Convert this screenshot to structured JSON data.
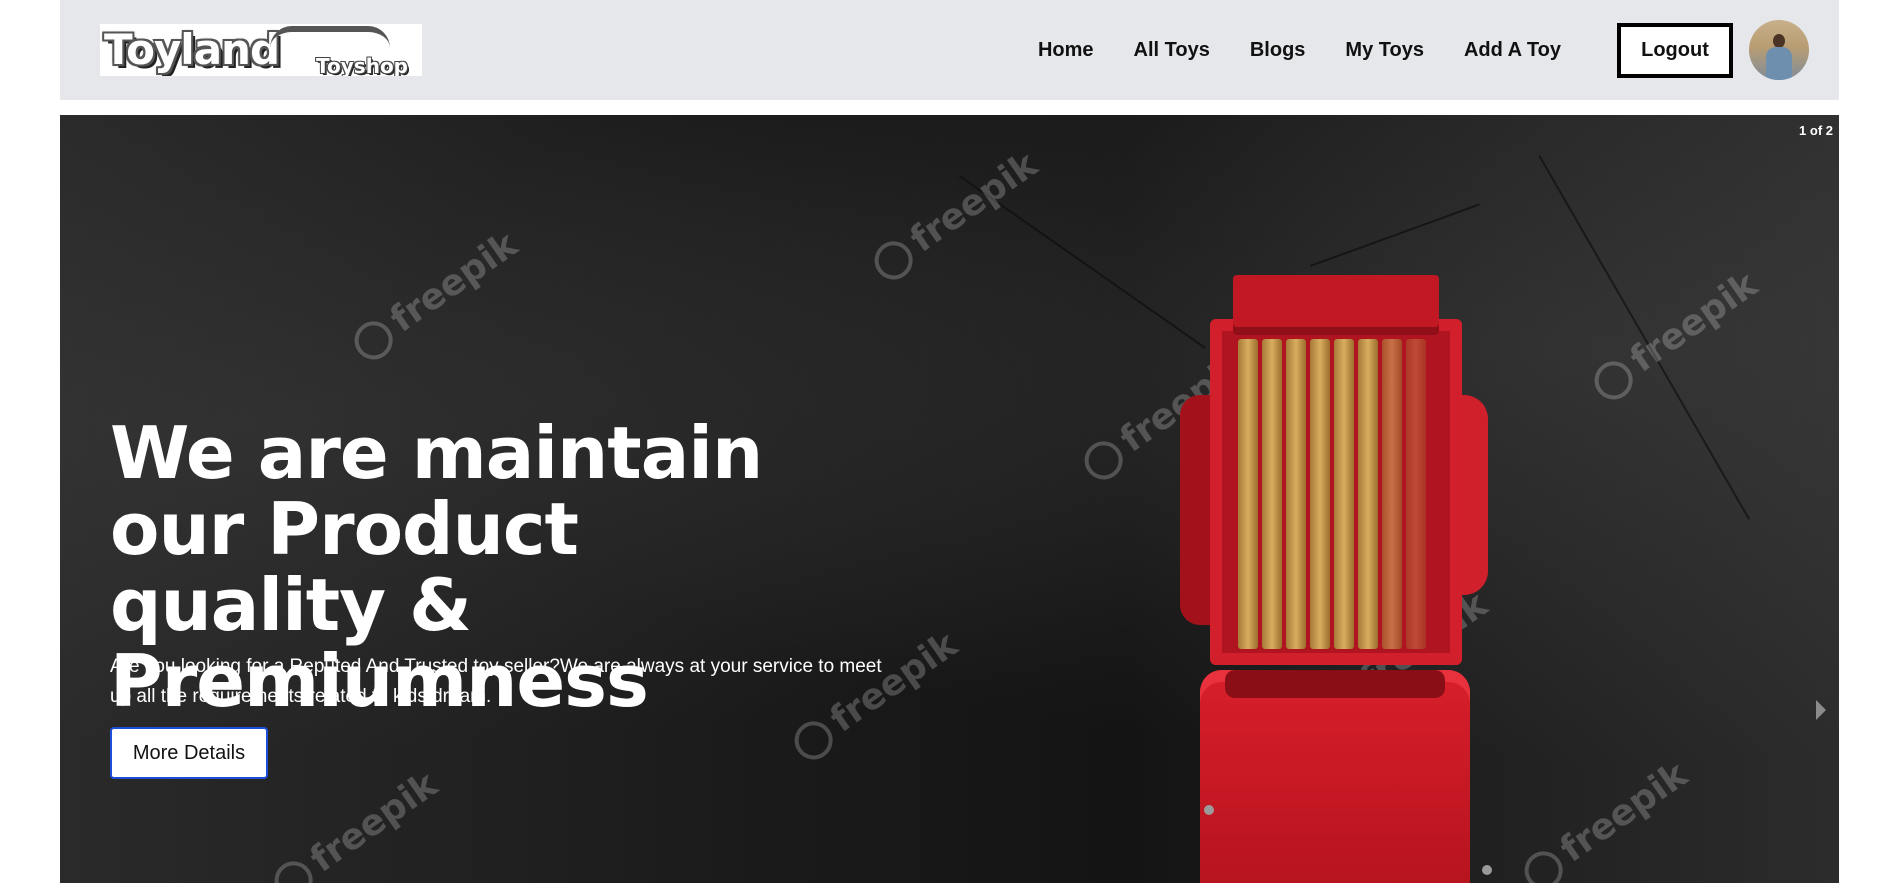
{
  "navbar": {
    "logo_text": "Toyland",
    "logo_subtext": "Toyshop",
    "links": [
      "Home",
      "All Toys",
      "Blogs",
      "My Toys",
      "Add A Toy"
    ],
    "logout_label": "Logout"
  },
  "hero": {
    "slide_counter": "1 of 2",
    "title": "We are maintain our Product quality & Premiumness",
    "subtitle": "Are you looking for a Reputed And Trusted toy seller?We are always at your service to meet up all the requirements related to kids dream.",
    "button_label": "More Details",
    "watermark": "freepik"
  },
  "icons": {
    "avatar": "user-avatar",
    "next": "chevron-right-icon",
    "truck": "red-toy-truck-image"
  },
  "colors": {
    "navbar_bg": "#e5e7eb",
    "button_border": "#1d4ed8",
    "truck_red": "#c11824"
  }
}
